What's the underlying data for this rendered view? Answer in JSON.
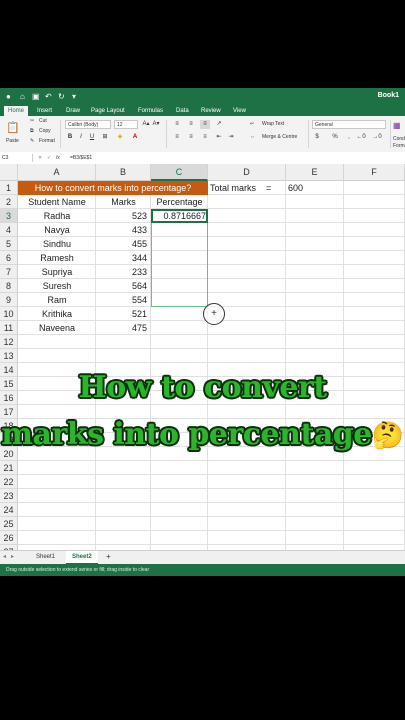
{
  "titlebar": {
    "title": "Book1"
  },
  "ribbon_tabs": [
    "Home",
    "Insert",
    "Draw",
    "Page Layout",
    "Formulas",
    "Data",
    "Review",
    "View"
  ],
  "ribbon": {
    "paste": "Paste",
    "cut": "Cut",
    "copy": "Copy",
    "format": "Format",
    "font_name": "Calibri (Body)",
    "font_size": "12",
    "wrap_text": "Wrap Text",
    "merge_center": "Merge & Centre",
    "number_format": "General",
    "cond_format": "Cond Form"
  },
  "formula_bar": {
    "name_box": "C3",
    "formula": "=B3/$E$1"
  },
  "columns": [
    "A",
    "B",
    "C",
    "D",
    "E",
    "F"
  ],
  "rows": [
    "1",
    "2",
    "3",
    "4",
    "5",
    "6",
    "7",
    "8",
    "9",
    "10",
    "11",
    "12",
    "13",
    "14",
    "15",
    "16",
    "17",
    "18",
    "19",
    "20",
    "21",
    "22",
    "23",
    "24",
    "25",
    "26",
    "27"
  ],
  "sheet": {
    "banner": "How to convert marks into percentage?",
    "total_label": "Total marks",
    "equals": "=",
    "total_value": "600",
    "headers": {
      "name": "Student Name",
      "marks": "Marks",
      "percentage": "Percentage"
    },
    "students": [
      {
        "name": "Radha",
        "marks": "523"
      },
      {
        "name": "Navya",
        "marks": "433"
      },
      {
        "name": "Sindhu",
        "marks": "455"
      },
      {
        "name": "Ramesh",
        "marks": "344"
      },
      {
        "name": "Supriya",
        "marks": "233"
      },
      {
        "name": "Suresh",
        "marks": "564"
      },
      {
        "name": "Ram",
        "marks": "554"
      },
      {
        "name": "Krithika",
        "marks": "521"
      },
      {
        "name": "Naveena",
        "marks": "475"
      }
    ],
    "c3_value": "0.8716667"
  },
  "caption": {
    "line1": "How to convert",
    "line2": "marks into percentage",
    "emoji": "🤔"
  },
  "sheet_tabs": [
    "Sheet1",
    "Sheet2"
  ],
  "add_sheet": "+",
  "status": "Drag outside selection to extend series or fill; drag inside to clear"
}
